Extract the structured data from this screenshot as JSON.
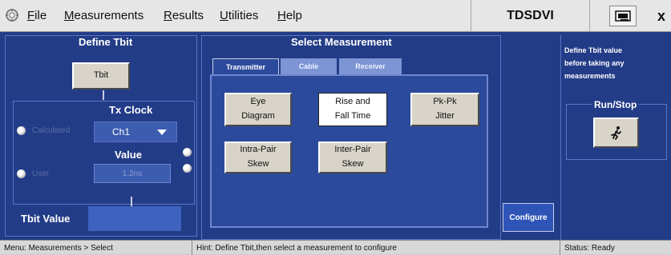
{
  "menubar": {
    "items": [
      {
        "label": "File",
        "underline": "F",
        "rest": "ile"
      },
      {
        "label": "Measurements",
        "underline": "M",
        "rest": "easurements"
      },
      {
        "label": "Results",
        "underline": "R",
        "rest": "esults"
      },
      {
        "label": "Utilities",
        "underline": "U",
        "rest": "tilities"
      },
      {
        "label": "Help",
        "underline": "H",
        "rest": "elp"
      }
    ],
    "app_name": "TDSDVI",
    "close_label": "x"
  },
  "define_tbit": {
    "title": "Define Tbit",
    "tbit_button": "Tbit",
    "tx_clock_label": "Tx Clock",
    "calculated_label": "Calculated",
    "clock_selected": "Ch1",
    "value_label": "Value",
    "user_label": "User",
    "user_value": "1.2ns",
    "tbit_value_label": "Tbit Value"
  },
  "select_measurement": {
    "title": "Select Measurement",
    "tabs": [
      "Transmitter",
      "Cable",
      "Receiver"
    ],
    "active_tab": "Transmitter",
    "buttons": {
      "eye_line1": "Eye",
      "eye_line2": "Diagram",
      "rise_line1": "Rise and",
      "rise_line2": "Fall Time",
      "pkpk_line1": "Pk-Pk",
      "pkpk_line2": "Jitter",
      "intra_line1": "Intra-Pair",
      "intra_line2": "Skew",
      "inter_line1": "Inter-Pair",
      "inter_line2": "Skew"
    },
    "configure_label": "Configure"
  },
  "info": {
    "hint_line1": "Define Tbit value",
    "hint_line2": "before taking any",
    "hint_line3": "measurements",
    "run_stop_label": "Run/Stop"
  },
  "statusbar": {
    "menu_path": "Menu: Measurements > Select",
    "hint": "Hint: Define Tbit,then select a measurement to configure",
    "status": "Status: Ready"
  },
  "colors": {
    "panel_bg": "#233c87",
    "tab_body_bg": "#2c4a9c",
    "button_face": "#d9d4ca",
    "highlight": "#c6cee5"
  }
}
